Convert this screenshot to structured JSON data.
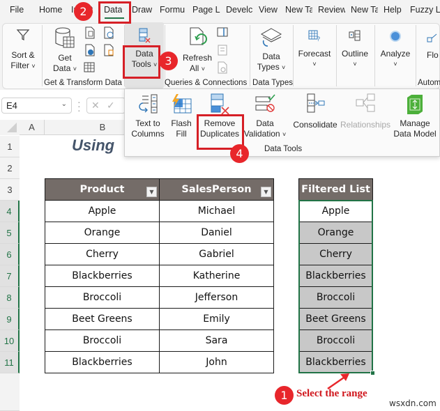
{
  "menu": {
    "tabs": [
      {
        "label": "File"
      },
      {
        "label": "Home"
      },
      {
        "label": "Insert"
      },
      {
        "label": "Data"
      },
      {
        "label": "Draw"
      },
      {
        "label": "Formu"
      },
      {
        "label": "Page L"
      },
      {
        "label": "Develc"
      },
      {
        "label": "View"
      },
      {
        "label": "New Ta"
      },
      {
        "label": "Review"
      },
      {
        "label": "New Ta"
      },
      {
        "label": "Help"
      },
      {
        "label": "Fuzzy L"
      }
    ],
    "active_tab": "Data"
  },
  "ribbon": {
    "sort_filter": {
      "line1": "Sort &",
      "line2": "Filter"
    },
    "get_data": {
      "line1": "Get",
      "line2": "Data"
    },
    "get_transform_label": "Get & Transform Data",
    "data_tools": {
      "line1": "Data",
      "line2": "Tools"
    },
    "refresh_all": {
      "line1": "Refresh",
      "line2": "All"
    },
    "queries_label": "Queries & Connections",
    "data_types": {
      "line1": "Data",
      "line2": "Types"
    },
    "data_types_label": "Data Types",
    "forecast": {
      "label": "Forecast"
    },
    "outline": {
      "label": "Outline"
    },
    "analyze": {
      "label": "Analyze"
    },
    "flow": {
      "label": "Flo"
    },
    "automate_label": "Autom",
    "chevron": "˅"
  },
  "flyout": {
    "text_to_columns": {
      "line1": "Text to",
      "line2": "Columns"
    },
    "flash_fill": {
      "line1": "Flash",
      "line2": "Fill"
    },
    "remove_duplicates": {
      "line1": "Remove",
      "line2": "Duplicates"
    },
    "data_validation": {
      "line1": "Data",
      "line2": "Validation"
    },
    "consolidate": {
      "label": "Consolidate"
    },
    "relationships": {
      "label": "Relationships"
    },
    "manage_data_model": {
      "line1": "Manage",
      "line2": "Data Model"
    },
    "group_label": "Data Tools"
  },
  "formula_bar": {
    "name_box": "E4",
    "cancel_icon": "✕",
    "enter_icon": "✓"
  },
  "grid": {
    "columns": [
      "A",
      "B"
    ],
    "rows": [
      "1",
      "2",
      "3",
      "4",
      "5",
      "6",
      "7",
      "8",
      "9",
      "10",
      "11"
    ],
    "title": "Using"
  },
  "table": {
    "headers": [
      "Product",
      "SalesPerson"
    ],
    "rows": [
      [
        "Apple",
        "Michael"
      ],
      [
        "Orange",
        "Daniel"
      ],
      [
        "Cherry",
        "Gabriel"
      ],
      [
        "Blackberries",
        "Katherine"
      ],
      [
        "Broccoli",
        "Jefferson"
      ],
      [
        "Beet Greens",
        "Emily"
      ],
      [
        "Broccoli",
        "Sara"
      ],
      [
        "Blackberries",
        "John"
      ]
    ]
  },
  "filtered_list": {
    "header": "Filtered List",
    "items": [
      "Apple",
      "Orange",
      "Cherry",
      "Blackberries",
      "Broccoli",
      "Beet Greens",
      "Broccoli",
      "Blackberries"
    ]
  },
  "annotations": {
    "step1": "1",
    "step2": "2",
    "step3": "3",
    "step4": "4",
    "step1_text": "Select the range",
    "accent_red": "#e8262b",
    "selection_green": "#217346"
  },
  "watermark": "wsxdn.com"
}
